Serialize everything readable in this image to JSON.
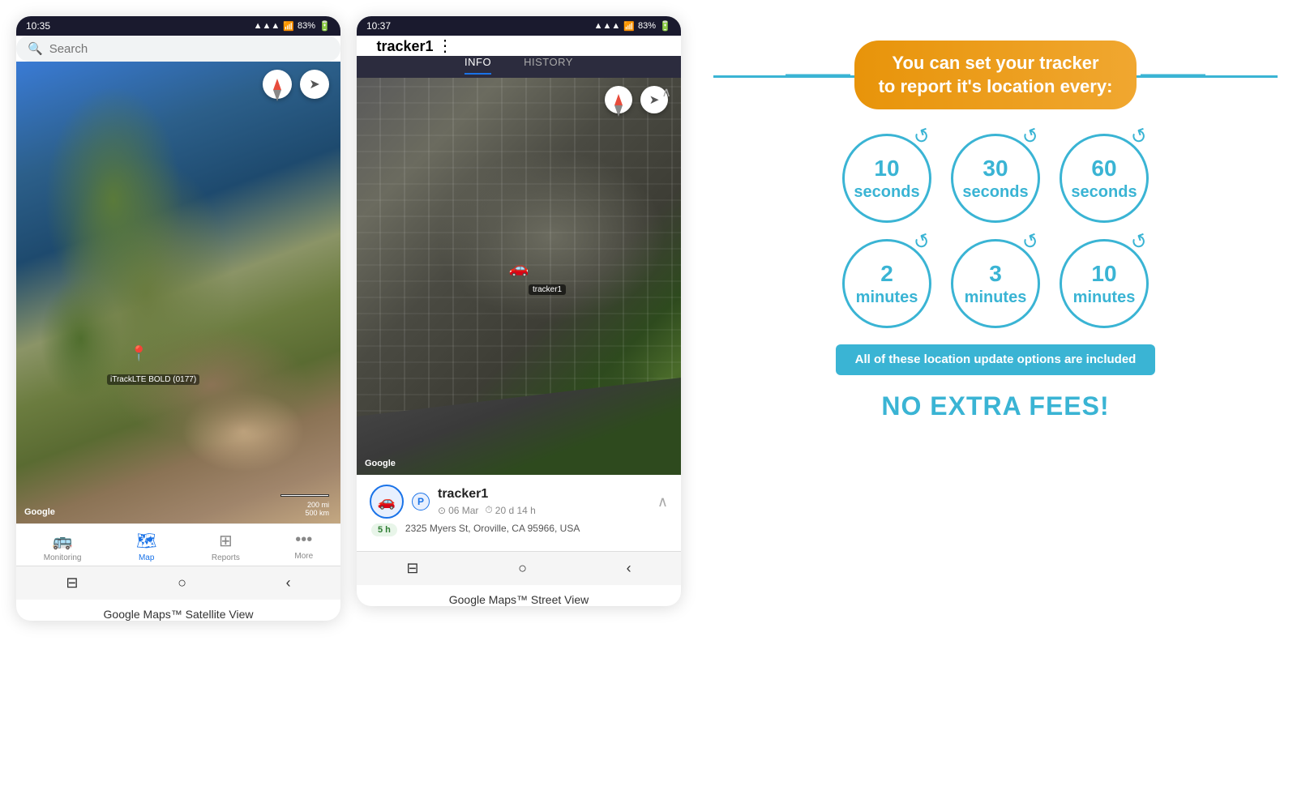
{
  "phone1": {
    "status_time": "10:35",
    "status_signal": "▲▲▲",
    "status_battery": "83%",
    "search_placeholder": "Search",
    "nav_items": [
      {
        "label": "Monitoring",
        "icon": "🚌",
        "active": false
      },
      {
        "label": "Map",
        "icon": "🗺",
        "active": true
      },
      {
        "label": "Reports",
        "icon": "⊞",
        "active": false
      },
      {
        "label": "More",
        "icon": "•••",
        "active": false
      }
    ],
    "map_watermark": "Google",
    "map_scale_text1": "200 mi",
    "map_scale_text2": "500 km",
    "tracker_label": "iTrackLTE BOLD (0177)",
    "caption": "Google Maps™ Satellite View"
  },
  "phone2": {
    "status_time": "10:37",
    "status_signal": "▲▲▲",
    "status_battery": "83%",
    "tracker_name": "tracker1",
    "tab_info": "INFO",
    "tab_history": "HISTORY",
    "map_watermark": "Google",
    "tracker_date": "06 Mar",
    "tracker_duration": "20 d 14 h",
    "tracker_address": "2325 Myers St, Oroville, CA 95966, USA",
    "tracker_badge": "5 h",
    "tracker_label_aerial": "tracker1",
    "caption": "Google Maps™ Street View"
  },
  "infographic": {
    "headline_line1": "You can set your tracker",
    "headline_line2": "to report it's location every:",
    "circles_row1": [
      {
        "number": "10",
        "unit": "seconds"
      },
      {
        "number": "30",
        "unit": "seconds"
      },
      {
        "number": "60",
        "unit": "seconds"
      }
    ],
    "circles_row2": [
      {
        "number": "2",
        "unit": "minutes"
      },
      {
        "number": "3",
        "unit": "minutes"
      },
      {
        "number": "10",
        "unit": "minutes"
      }
    ],
    "included_text": "All of these location update options are included",
    "no_fees_text": "NO EXTRA FEES!"
  }
}
